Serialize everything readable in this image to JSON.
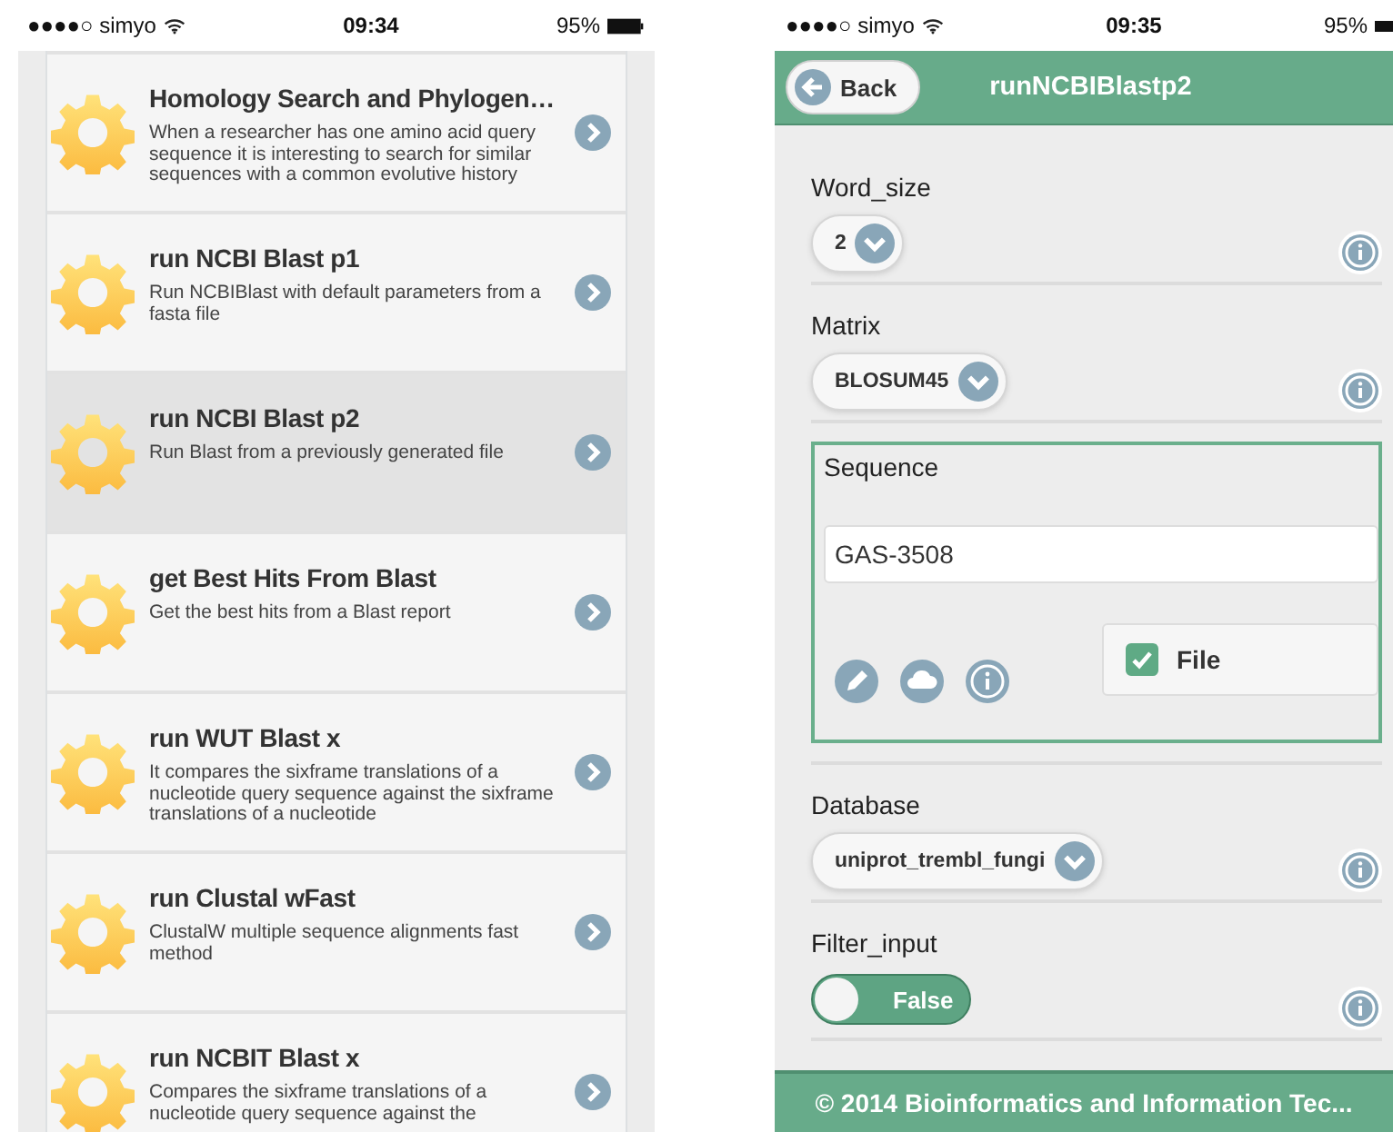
{
  "left_screen": {
    "status_bar": {
      "carrier": "●●●●○ simyo",
      "time": "09:34",
      "battery": "95%"
    },
    "tools": [
      {
        "title": "Homology Search and Phylogen…",
        "description": "When a researcher has one amino acid query sequence it is interesting to search for similar sequences with a common evolutive history",
        "selected": false
      },
      {
        "title": "run NCBI Blast p1",
        "description": "Run NCBIBlast with default parameters from a fasta file",
        "selected": false
      },
      {
        "title": "run NCBI Blast p2",
        "description": "Run Blast from a previously generated file",
        "selected": true
      },
      {
        "title": "get Best Hits From Blast",
        "description": "Get the best hits from a Blast report",
        "selected": false
      },
      {
        "title": "run WUT Blast x",
        "description": "It compares the sixframe translations of a nucleotide query sequence against the sixframe translations of a nucleotide",
        "selected": false
      },
      {
        "title": "run Clustal wFast",
        "description": "ClustalW multiple sequence alignments fast method",
        "selected": false
      },
      {
        "title": "run NCBIT Blast x",
        "description": "Compares the sixframe translations of a nucleotide query sequence against the",
        "selected": false
      }
    ]
  },
  "right_screen": {
    "status_bar": {
      "carrier": "●●●●○ simyo",
      "time": "09:35",
      "battery": "95%"
    },
    "header": {
      "back": "Back",
      "title": "runNCBIBlastp2"
    },
    "params": [
      {
        "kind": "select",
        "label": "Word_size",
        "value": "2"
      },
      {
        "kind": "select",
        "label": "Matrix",
        "value": "BLOSUM45"
      },
      {
        "kind": "sequence",
        "label": "Sequence",
        "value": "GAS-3508",
        "file_label": "File",
        "checked": true
      },
      {
        "kind": "select",
        "label": "Database",
        "value": "uniprot_trembl_fungi"
      },
      {
        "kind": "toggle",
        "label": "Filter_input",
        "value": "False",
        "on": false
      }
    ],
    "footer": "© 2014 Bioinformatics and Information Tec..."
  }
}
